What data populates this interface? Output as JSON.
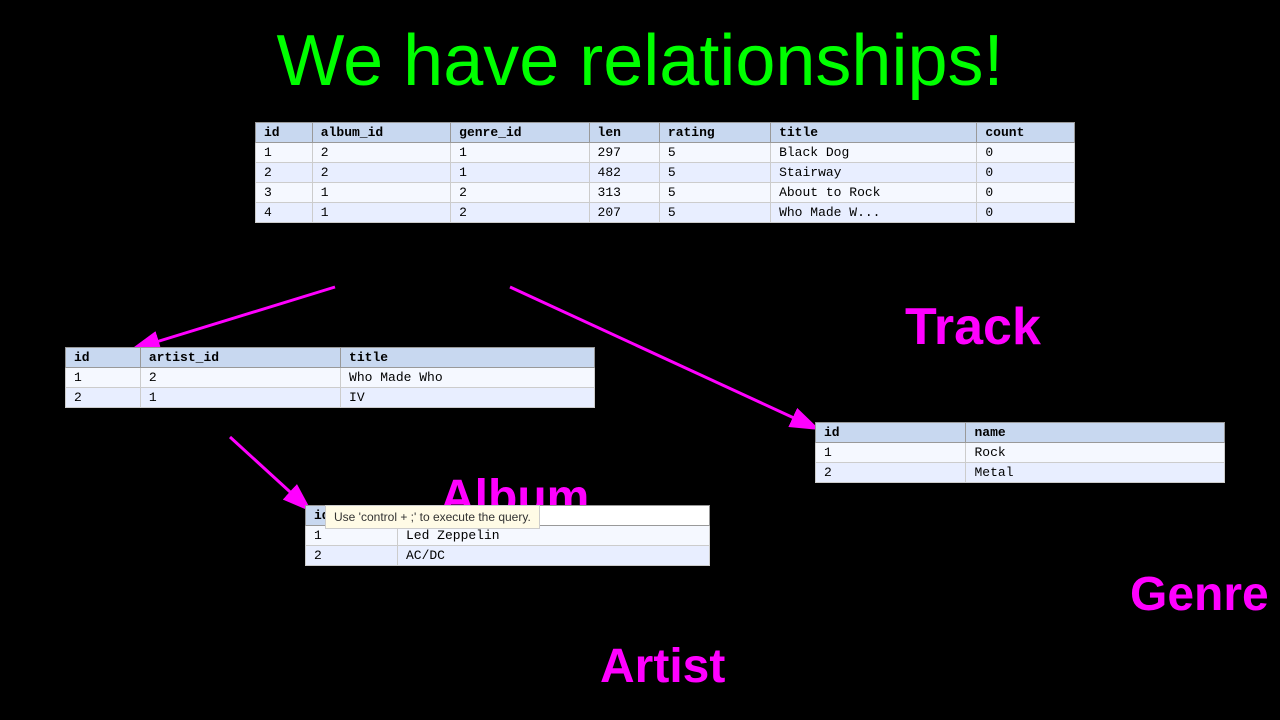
{
  "page": {
    "title": "We have relationships!",
    "background": "#000000"
  },
  "labels": {
    "track": "Track",
    "album": "Album",
    "genre": "Genre",
    "artist": "Artist"
  },
  "track_table": {
    "columns": [
      "id",
      "album_id",
      "genre_id",
      "len",
      "rating",
      "title",
      "count"
    ],
    "rows": [
      [
        "1",
        "2",
        "1",
        "297",
        "5",
        "Black Dog",
        "0"
      ],
      [
        "2",
        "2",
        "1",
        "482",
        "5",
        "Stairway",
        "0"
      ],
      [
        "3",
        "1",
        "2",
        "313",
        "5",
        "About to Rock",
        "0"
      ],
      [
        "4",
        "1",
        "2",
        "207",
        "5",
        "Who Made W...",
        "0"
      ]
    ]
  },
  "album_table": {
    "columns": [
      "id",
      "artist_id",
      "title"
    ],
    "rows": [
      [
        "1",
        "2",
        "Who Made Who"
      ],
      [
        "2",
        "1",
        "IV"
      ]
    ]
  },
  "genre_table": {
    "columns": [
      "id",
      "name"
    ],
    "rows": [
      [
        "1",
        "Rock"
      ],
      [
        "2",
        "Metal"
      ]
    ]
  },
  "artist_table": {
    "columns": [
      "id"
    ],
    "rows": [
      [
        "1",
        "Led Zeppelin"
      ],
      [
        "2",
        "AC/DC"
      ]
    ]
  },
  "tooltip": {
    "text": "Use 'control + ;' to execute the query."
  }
}
